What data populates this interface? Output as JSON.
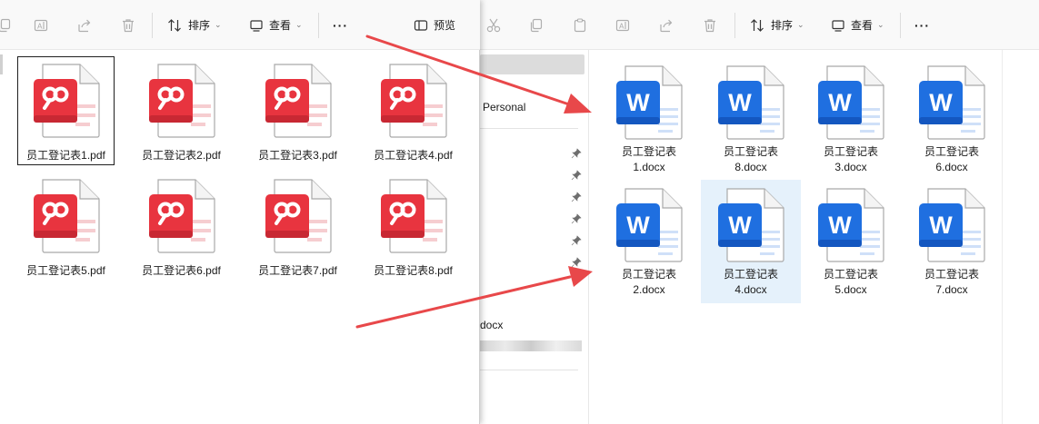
{
  "front_toolbar": {
    "sort_label": "排序",
    "view_label": "查看",
    "more_label": "···",
    "preview_label": "预览"
  },
  "back_toolbar": {
    "sort_label": "排序",
    "view_label": "查看",
    "more_label": "···"
  },
  "nav": {
    "personal_label": "Personal",
    "recent_label": "docx"
  },
  "pdf_files": [
    {
      "name": "员工登记表1.pdf"
    },
    {
      "name": "员工登记表2.pdf"
    },
    {
      "name": "员工登记表3.pdf"
    },
    {
      "name": "员工登记表4.pdf"
    },
    {
      "name": "员工登记表5.pdf"
    },
    {
      "name": "员工登记表6.pdf"
    },
    {
      "name": "员工登记表7.pdf"
    },
    {
      "name": "员工登记表8.pdf"
    }
  ],
  "docx_files": [
    {
      "line1": "员工登记表",
      "line2": "1.docx"
    },
    {
      "line1": "员工登记表",
      "line2": "8.docx"
    },
    {
      "line1": "员工登记表",
      "line2": "3.docx"
    },
    {
      "line1": "员工登记表",
      "line2": "6.docx"
    },
    {
      "line1": "员工登记表",
      "line2": "2.docx"
    },
    {
      "line1": "员工登记表",
      "line2": "4.docx"
    },
    {
      "line1": "员工登记表",
      "line2": "5.docx"
    },
    {
      "line1": "员工登记表",
      "line2": "7.docx"
    }
  ],
  "colors": {
    "pdf_red": "#e8343f",
    "word_blue": "#1f6fe0",
    "arrow_red": "#e8484a",
    "selection": "#e5f1fb"
  },
  "icons": {
    "pdf": "wps-pdf-file-icon",
    "word": "word-docx-file-icon"
  }
}
